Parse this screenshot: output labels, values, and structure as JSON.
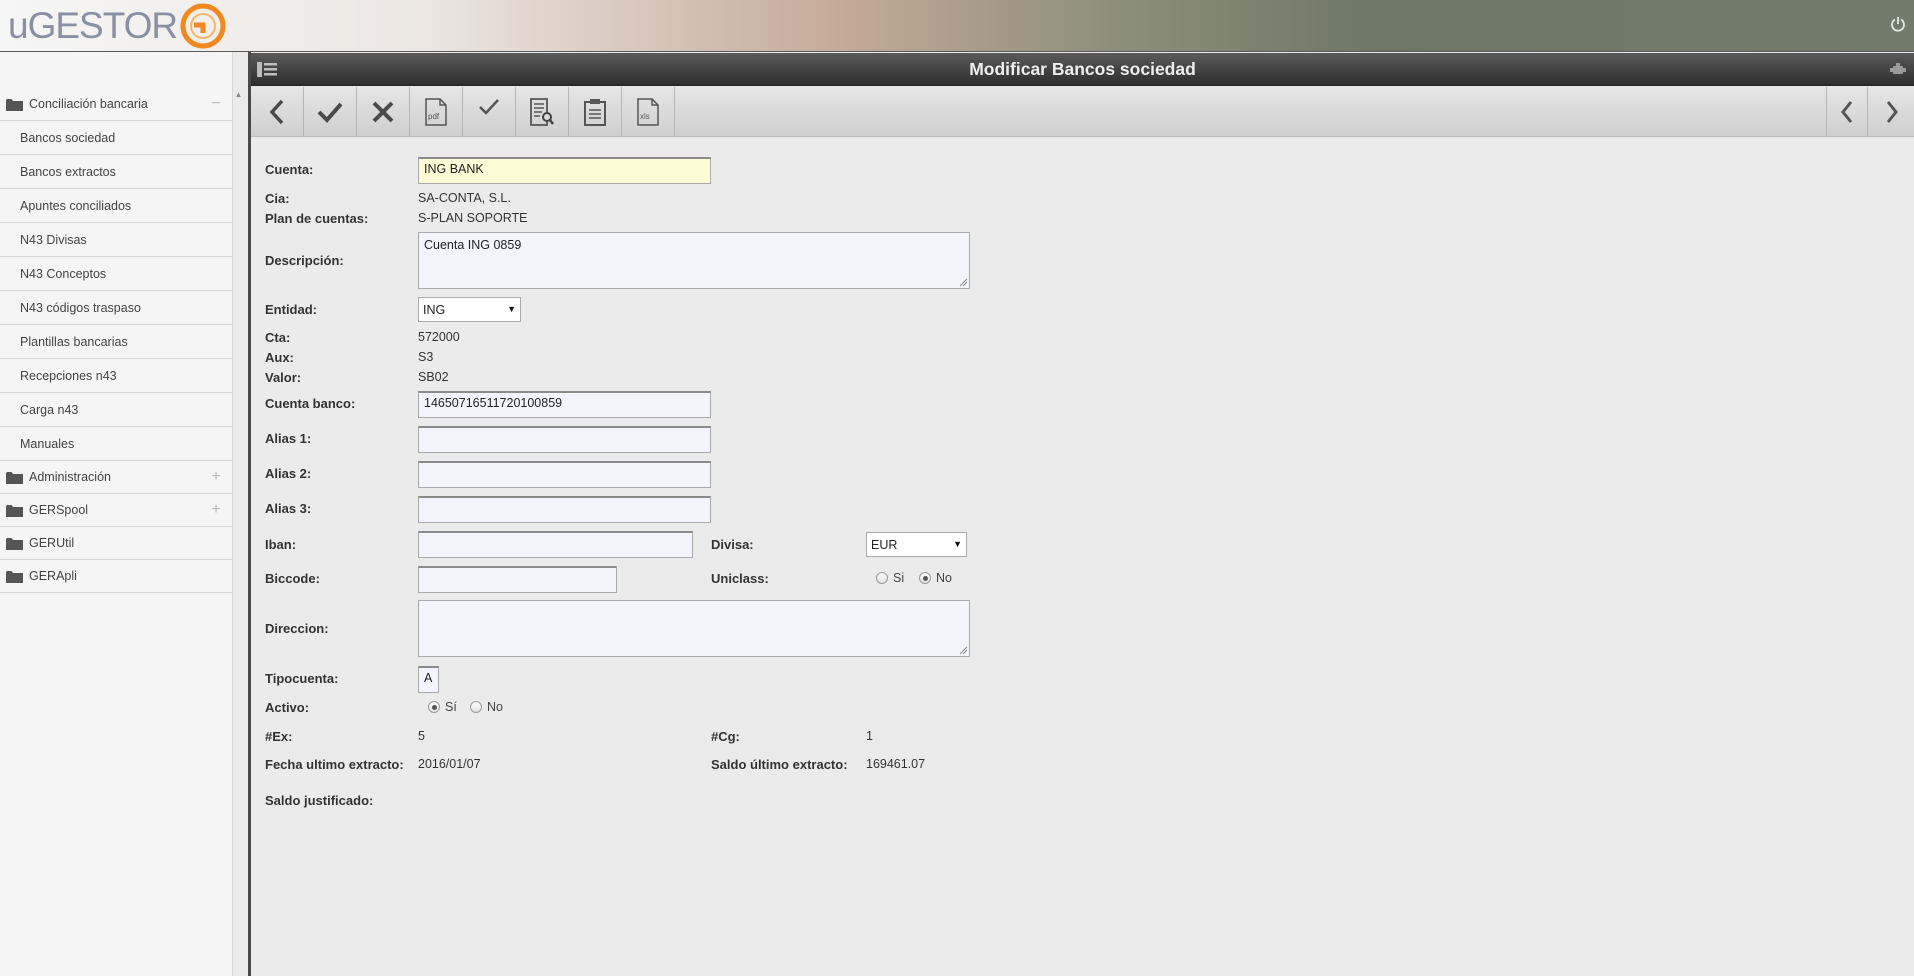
{
  "app": {
    "logo_text": "uGESTOR",
    "logo_subtitle": ""
  },
  "header": {
    "title": "Modificar Bancos sociedad"
  },
  "sidebar": {
    "groups": [
      {
        "label": "Conciliación bancaria",
        "toggle": "−",
        "expanded": true
      },
      {
        "label": "Administración",
        "toggle": "+"
      },
      {
        "label": "GERSpool",
        "toggle": "+"
      },
      {
        "label": "GERUtil"
      },
      {
        "label": "GERApli"
      }
    ],
    "items": [
      "Bancos sociedad",
      "Bancos extractos",
      "Apuntes conciliados",
      "N43 Divisas",
      "N43 Conceptos",
      "N43 códigos traspaso",
      "Plantillas bancarias",
      "Recepciones n43",
      "Carga n43",
      "Manuales"
    ]
  },
  "toolbar": {
    "buttons": [
      {
        "name": "back-icon"
      },
      {
        "name": "accept-icon"
      },
      {
        "name": "cancel-icon"
      },
      {
        "name": "pdf-icon",
        "label": "pdf"
      },
      {
        "name": "check-icon"
      },
      {
        "name": "document-search-icon"
      },
      {
        "name": "clipboard-icon"
      },
      {
        "name": "xls-icon",
        "label": "xls"
      }
    ]
  },
  "form": {
    "cuenta": {
      "label": "Cuenta:",
      "value": "ING BANK"
    },
    "cia": {
      "label": "Cia:",
      "value": "SA-CONTA, S.L."
    },
    "plan": {
      "label": "Plan de cuentas:",
      "value": "S-PLAN SOPORTE"
    },
    "descripcion": {
      "label": "Descripción:",
      "value": "Cuenta ING 0859"
    },
    "entidad": {
      "label": "Entidad:",
      "value": "ING"
    },
    "cta": {
      "label": "Cta:",
      "value": "572000"
    },
    "aux": {
      "label": "Aux:",
      "value": "S3"
    },
    "valor": {
      "label": "Valor:",
      "value": "SB02"
    },
    "cuenta_banco": {
      "label": "Cuenta banco:",
      "value": "14650716511720100859"
    },
    "alias1": {
      "label": "Alias 1:",
      "value": ""
    },
    "alias2": {
      "label": "Alias 2:",
      "value": ""
    },
    "alias3": {
      "label": "Alias 3:",
      "value": ""
    },
    "iban": {
      "label": "Iban:",
      "value": ""
    },
    "divisa": {
      "label": "Divisa:",
      "value": "EUR"
    },
    "biccode": {
      "label": "Biccode:",
      "value": ""
    },
    "uniclass": {
      "label": "Uniclass:",
      "options": [
        "Si",
        "No"
      ],
      "selected": "No"
    },
    "direccion": {
      "label": "Direccion:",
      "value": ""
    },
    "tipocuenta": {
      "label": "Tipocuenta:",
      "value": "A"
    },
    "activo": {
      "label": "Activo:",
      "options": [
        "Sí",
        "No"
      ],
      "selected": "Sí"
    },
    "ex": {
      "label": "#Ex:",
      "value": "5"
    },
    "cg": {
      "label": "#Cg:",
      "value": "1"
    },
    "fecha_ultimo": {
      "label": "Fecha ultimo extracto:",
      "value": "2016/01/07"
    },
    "saldo_ultimo": {
      "label": "Saldo último extracto:",
      "value": "169461.07"
    },
    "saldo_justificado": {
      "label": "Saldo justificado:",
      "value": ""
    }
  }
}
